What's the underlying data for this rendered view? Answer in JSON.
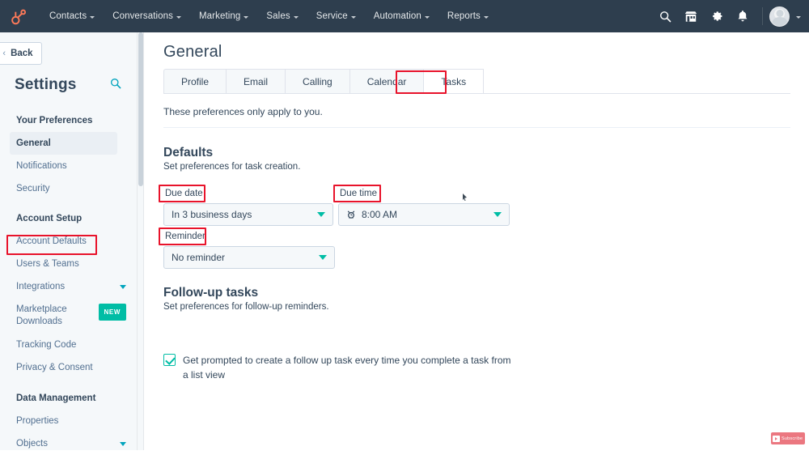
{
  "topnav": {
    "logo": "hubspot-sprocket-logo",
    "items": [
      {
        "label": "Contacts",
        "icon": "chevron-down-icon"
      },
      {
        "label": "Conversations",
        "icon": "chevron-down-icon"
      },
      {
        "label": "Marketing",
        "icon": "chevron-down-icon"
      },
      {
        "label": "Sales",
        "icon": "chevron-down-icon"
      },
      {
        "label": "Service",
        "icon": "chevron-down-icon"
      },
      {
        "label": "Automation",
        "icon": "chevron-down-icon"
      },
      {
        "label": "Reports",
        "icon": "chevron-down-icon"
      }
    ],
    "right_icons": [
      "search-icon",
      "marketplace-icon",
      "settings-gear-icon",
      "notifications-bell-icon"
    ],
    "avatar": "user-avatar",
    "account_caret": "chevron-down-icon",
    "background_color": "#2e3e4e"
  },
  "sidebar": {
    "back_label": "Back",
    "back_icon": "chevron-left-icon",
    "title": "Settings",
    "search_icon": "search-icon",
    "groups": [
      {
        "heading": "Your Preferences",
        "items": [
          {
            "label": "General",
            "active": true
          },
          {
            "label": "Notifications",
            "active": false
          },
          {
            "label": "Security",
            "active": false
          }
        ]
      },
      {
        "heading": "Account Setup",
        "items": [
          {
            "label": "Account Defaults",
            "active": false,
            "highlighted": true
          },
          {
            "label": "Users & Teams",
            "active": false
          },
          {
            "label": "Integrations",
            "active": false,
            "caret": "chevron-down-icon"
          },
          {
            "label": "Marketplace Downloads",
            "active": false,
            "badge": "NEW"
          },
          {
            "label": "Tracking Code",
            "active": false
          },
          {
            "label": "Privacy & Consent",
            "active": false
          }
        ]
      },
      {
        "heading": "Data Management",
        "items": [
          {
            "label": "Properties",
            "active": false
          },
          {
            "label": "Objects",
            "active": false,
            "caret": "chevron-down-icon"
          }
        ]
      }
    ]
  },
  "main": {
    "page_title": "General",
    "tabs": [
      {
        "label": "Profile",
        "active": false
      },
      {
        "label": "Email",
        "active": false
      },
      {
        "label": "Calling",
        "active": false
      },
      {
        "label": "Calendar",
        "active": false
      },
      {
        "label": "Tasks",
        "active": true
      }
    ],
    "note": "These preferences only apply to you.",
    "defaults": {
      "title": "Defaults",
      "subtitle": "Set preferences for task creation.",
      "due_date": {
        "label": "Due date",
        "value": "In 3 business days",
        "caret": "chevron-down-icon"
      },
      "due_time": {
        "label": "Due time",
        "value": "8:00 AM",
        "icon": "alarm-clock-icon",
        "caret": "chevron-down-icon"
      },
      "reminder": {
        "label": "Reminder",
        "value": "No reminder",
        "caret": "chevron-down-icon"
      }
    },
    "followup": {
      "title": "Follow-up tasks",
      "subtitle": "Set preferences for follow-up reminders.",
      "checkbox_label": "Get prompted to create a follow up task every time you complete a task from a list view",
      "checked": true
    }
  },
  "overlay": {
    "subscribe_label": "Subscribe",
    "subscribe_icon": "youtube-icon"
  },
  "colors": {
    "nav_bg": "#2e3e4e",
    "accent_teal": "#00bda5",
    "link_teal": "#00a4bd",
    "text_dark": "#33475b",
    "text_muted": "#516f90",
    "annotation_red": "#e8132b",
    "sidebar_bg": "#f5f8fa"
  }
}
